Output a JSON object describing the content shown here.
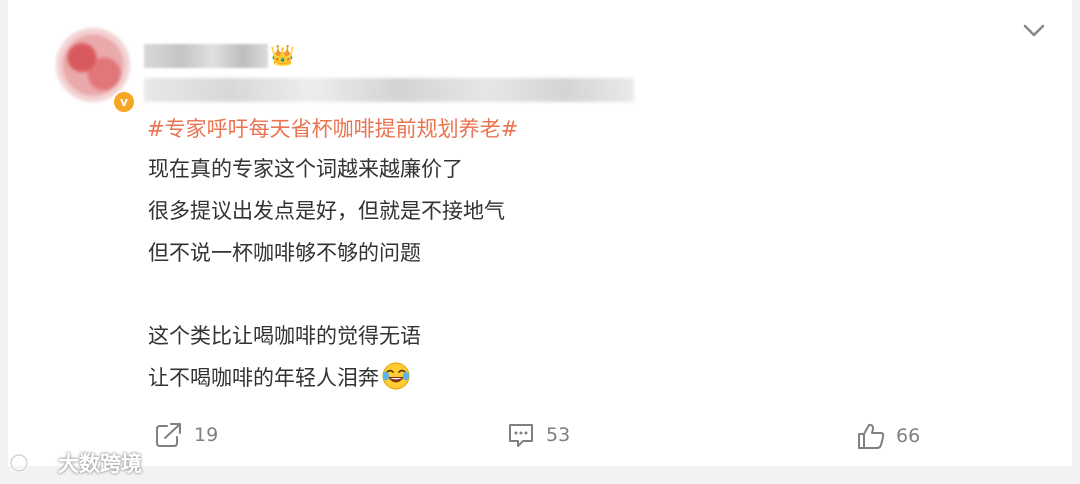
{
  "post": {
    "topic": "#专家呼吁每天省杯咖啡提前规划养老#",
    "lines": [
      "现在真的专家这个词越来越廉价了",
      "很多提议出发点是好，但就是不接地气",
      "但不说一杯咖啡够不够的问题",
      "",
      "这个类比让喝咖啡的觉得无语",
      "让不喝咖啡的年轻人泪奔"
    ]
  },
  "actions": {
    "share_count": "19",
    "comment_count": "53",
    "like_count": "66"
  },
  "watermark": {
    "text": "大数跨境"
  },
  "colors": {
    "topic": "#eb7350",
    "body_text": "#333333",
    "action_text": "#808080",
    "verified_badge": "#f5a623"
  },
  "icons": [
    "avatar",
    "verified-badge-icon",
    "vip-icon",
    "chevron-down-icon",
    "share-icon",
    "comment-icon",
    "like-icon",
    "laugh-cry-emoji",
    "watermark-logo-icon"
  ]
}
